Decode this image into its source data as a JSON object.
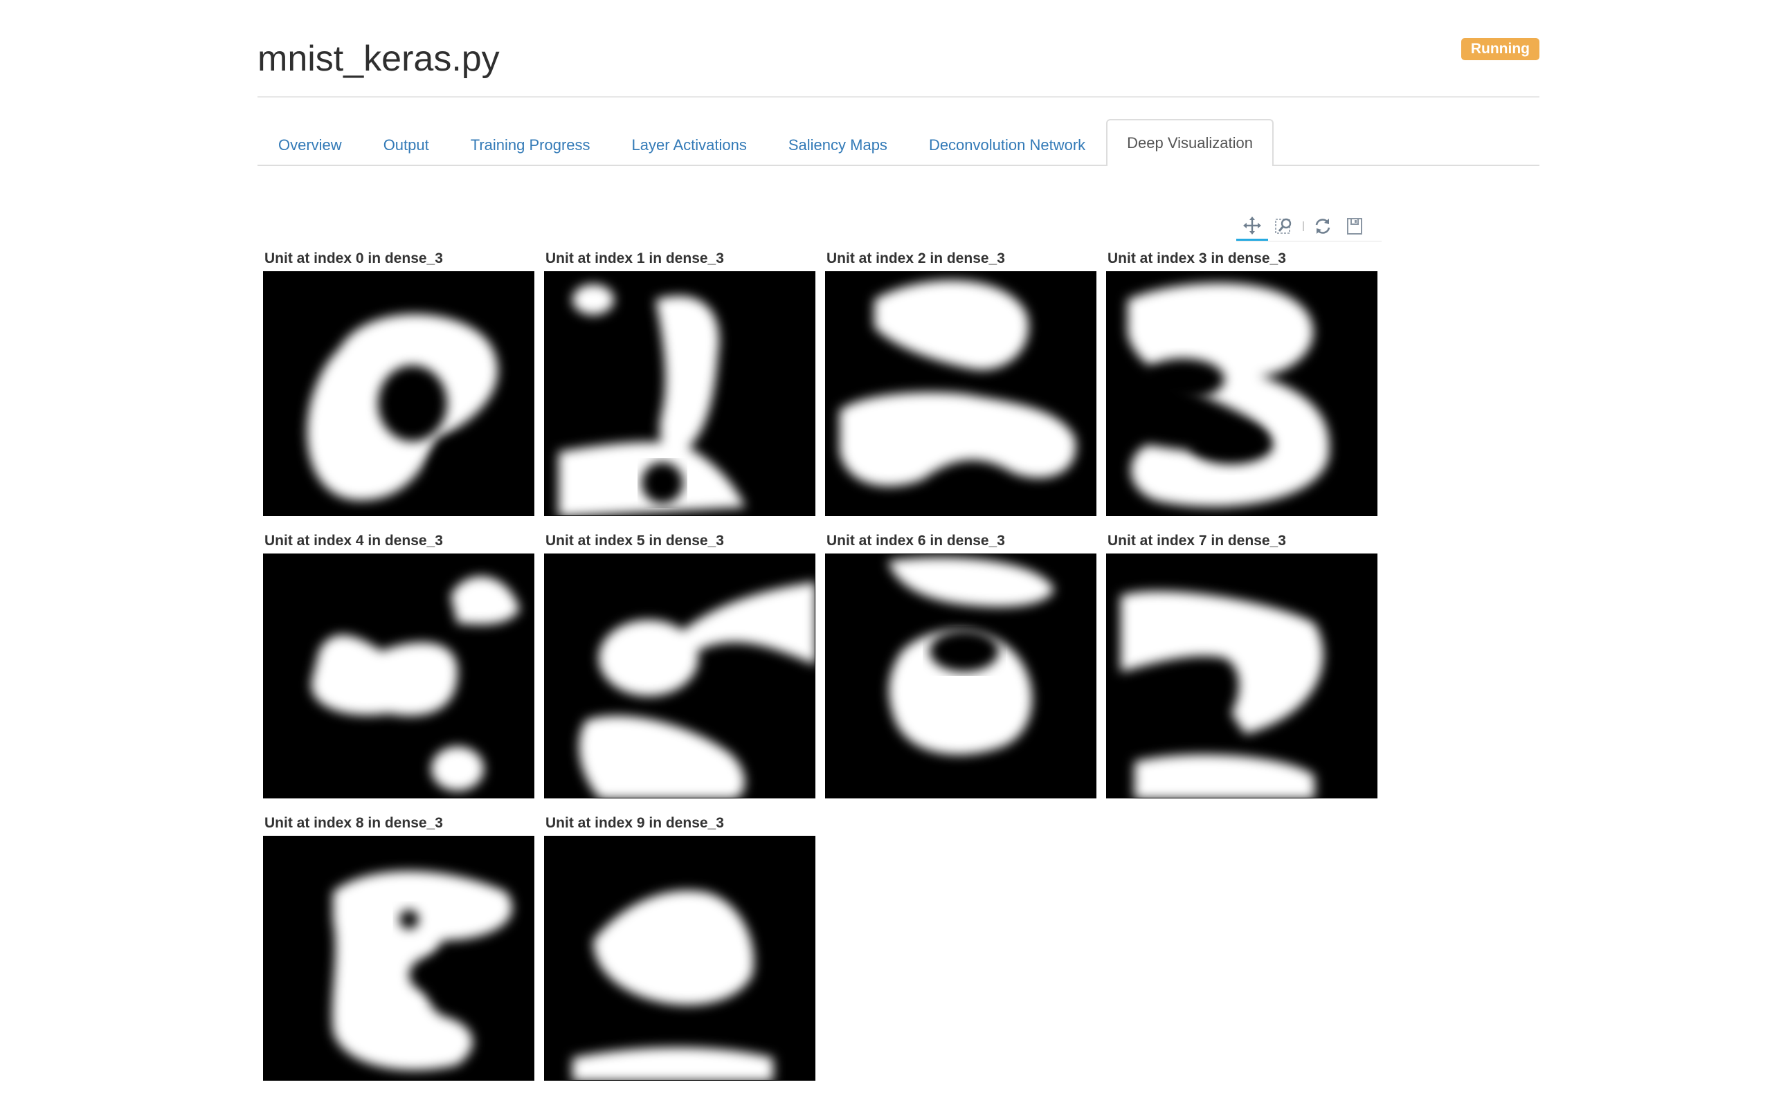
{
  "header": {
    "title": "mnist_keras.py",
    "status": "Running",
    "status_color": "#f0ad4e"
  },
  "tabs": [
    {
      "label": "Overview",
      "active": false
    },
    {
      "label": "Output",
      "active": false
    },
    {
      "label": "Training Progress",
      "active": false
    },
    {
      "label": "Layer Activations",
      "active": false
    },
    {
      "label": "Saliency Maps",
      "active": false
    },
    {
      "label": "Deconvolution Network",
      "active": false
    },
    {
      "label": "Deep Visualization",
      "active": true
    }
  ],
  "toolbar": {
    "tools": [
      {
        "name": "pan-icon",
        "active": true
      },
      {
        "name": "box-zoom-icon",
        "active": false
      },
      {
        "name": "reset-icon",
        "active": false
      },
      {
        "name": "save-icon",
        "active": false
      }
    ],
    "accent_color": "#26aae1"
  },
  "visualizations": [
    {
      "label": "Unit at index 0 in dense_3"
    },
    {
      "label": "Unit at index 1 in dense_3"
    },
    {
      "label": "Unit at index 2 in dense_3"
    },
    {
      "label": "Unit at index 3 in dense_3"
    },
    {
      "label": "Unit at index 4 in dense_3"
    },
    {
      "label": "Unit at index 5 in dense_3"
    },
    {
      "label": "Unit at index 6 in dense_3"
    },
    {
      "label": "Unit at index 7 in dense_3"
    },
    {
      "label": "Unit at index 8 in dense_3"
    },
    {
      "label": "Unit at index 9 in dense_3"
    }
  ]
}
